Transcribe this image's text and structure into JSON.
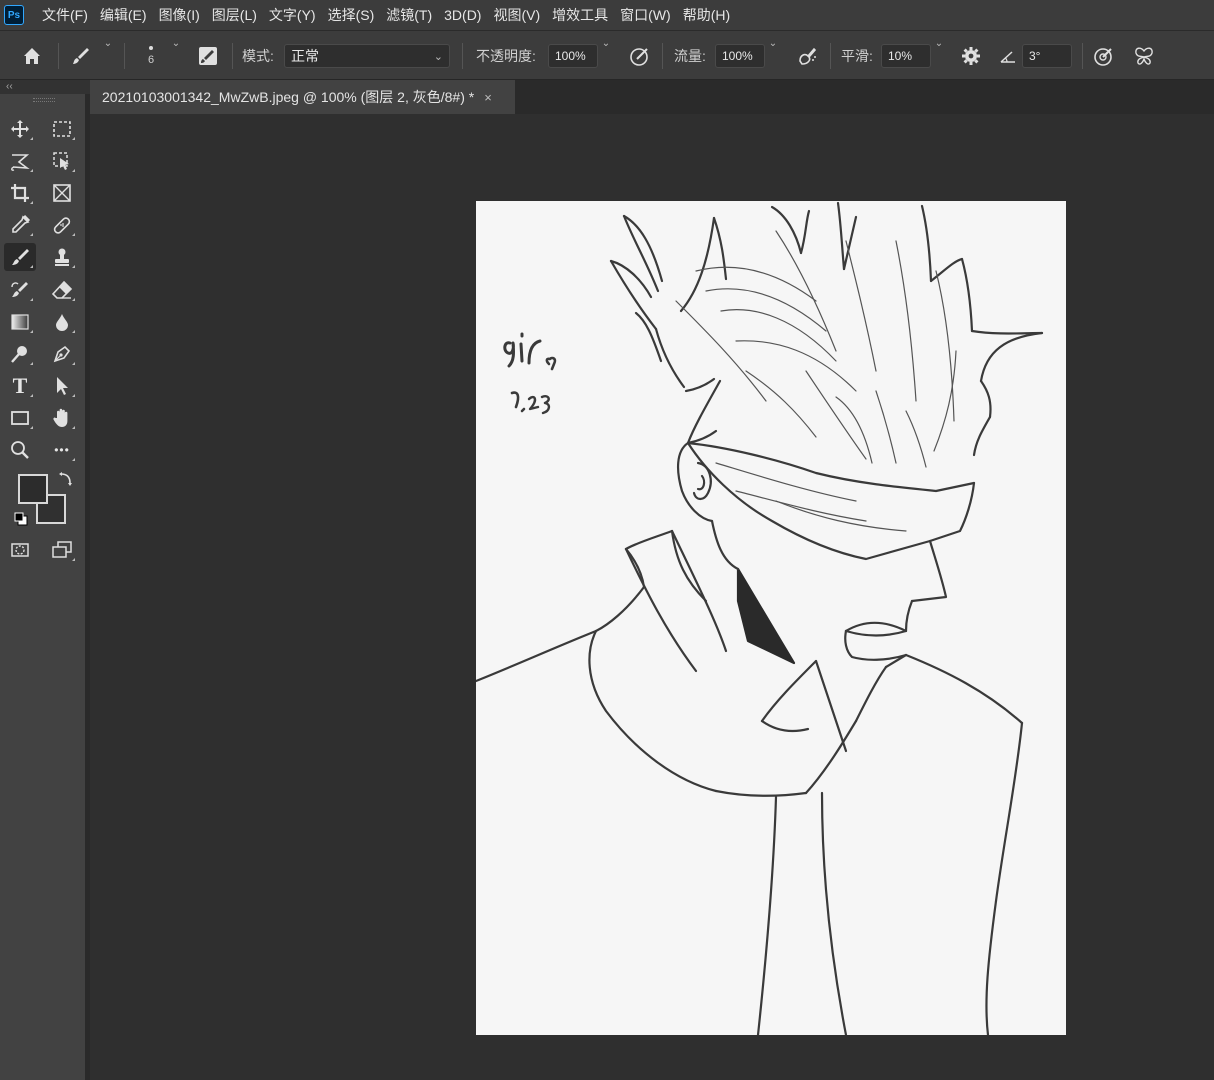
{
  "app": {
    "logo_text": "Ps"
  },
  "menu": {
    "items": [
      "文件(F)",
      "编辑(E)",
      "图像(I)",
      "图层(L)",
      "文字(Y)",
      "选择(S)",
      "滤镜(T)",
      "3D(D)",
      "视图(V)",
      "增效工具",
      "窗口(W)",
      "帮助(H)"
    ]
  },
  "options": {
    "brush_size": "6",
    "mode_label": "模式:",
    "mode_value": "正常",
    "opacity_label": "不透明度:",
    "opacity_value": "100%",
    "flow_label": "流量:",
    "flow_value": "100%",
    "smoothing_label": "平滑:",
    "smoothing_value": "10%",
    "angle_value": "3°"
  },
  "panel": {
    "collapse_glyph": "‹‹"
  },
  "document": {
    "tab_title": "20210103001342_MwZwB.jpeg @ 100% (图层 2, 灰色/8#) *",
    "close_glyph": "×"
  },
  "toolbar": {
    "tools": [
      {
        "name": "move-tool",
        "icon": "move-icon"
      },
      {
        "name": "rect-marquee-tool",
        "icon": "marquee-icon"
      },
      {
        "name": "lasso-tool",
        "icon": "lasso-icon"
      },
      {
        "name": "object-select-tool",
        "icon": "object-select-icon"
      },
      {
        "name": "crop-tool",
        "icon": "crop-icon"
      },
      {
        "name": "frame-tool",
        "icon": "frame-icon"
      },
      {
        "name": "eyedropper-tool",
        "icon": "eyedropper-icon"
      },
      {
        "name": "healing-brush-tool",
        "icon": "bandage-icon"
      },
      {
        "name": "brush-tool",
        "icon": "brush-icon",
        "active": true
      },
      {
        "name": "clone-stamp-tool",
        "icon": "stamp-icon"
      },
      {
        "name": "history-brush-tool",
        "icon": "history-brush-icon"
      },
      {
        "name": "eraser-tool",
        "icon": "eraser-icon"
      },
      {
        "name": "gradient-tool",
        "icon": "gradient-icon"
      },
      {
        "name": "blur-tool",
        "icon": "drop-icon"
      },
      {
        "name": "dodge-tool",
        "icon": "dodge-icon"
      },
      {
        "name": "pen-tool",
        "icon": "pen-icon"
      },
      {
        "name": "type-tool",
        "icon": "type-icon"
      },
      {
        "name": "path-select-tool",
        "icon": "arrow-icon"
      },
      {
        "name": "rectangle-tool",
        "icon": "rectangle-icon"
      },
      {
        "name": "hand-tool",
        "icon": "hand-icon"
      },
      {
        "name": "zoom-tool",
        "icon": "zoom-icon"
      },
      {
        "name": "more-tools",
        "icon": "ellipsis-icon"
      }
    ],
    "type_glyph": "T",
    "ellipsis_glyph": "•••"
  },
  "colors": {
    "foreground": "#2c2c2c",
    "background": "#303030",
    "accent": "#31a8ff"
  },
  "artwork": {
    "signature": "gir",
    "date": "1.23"
  }
}
